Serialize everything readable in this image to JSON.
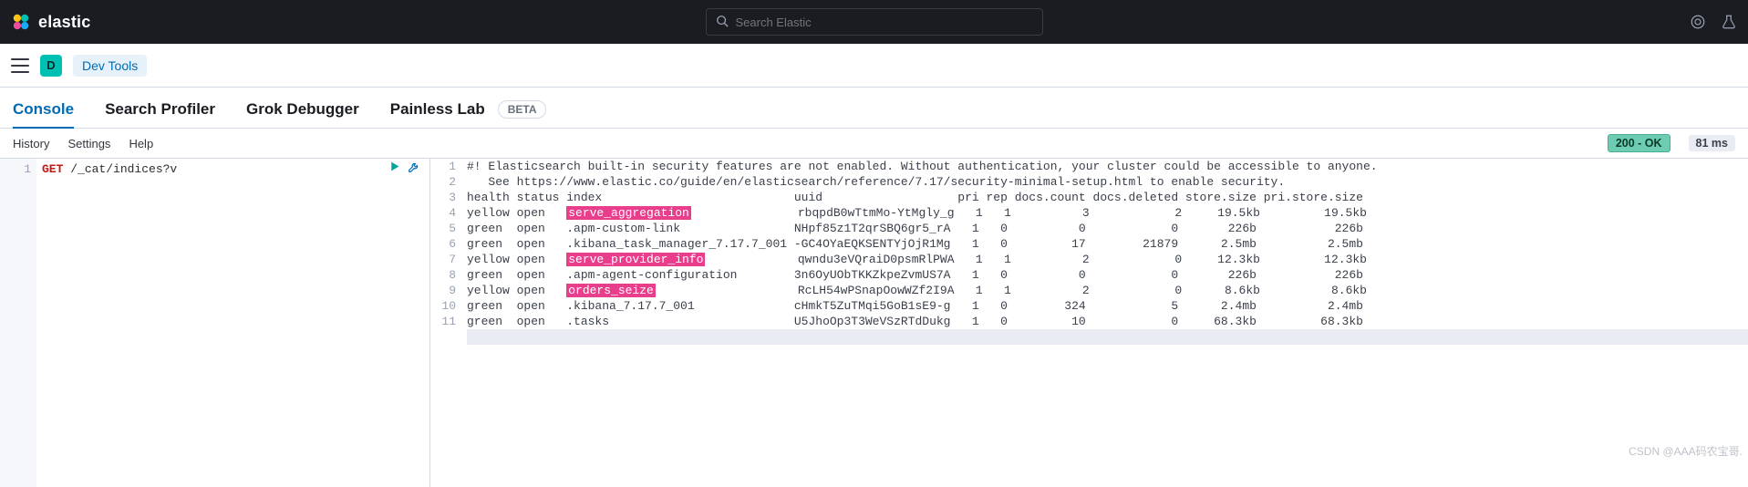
{
  "header": {
    "brand": "elastic",
    "search_placeholder": "Search Elastic"
  },
  "secondbar": {
    "space_letter": "D",
    "breadcrumb": "Dev Tools"
  },
  "tabs": {
    "console": "Console",
    "search_profiler": "Search Profiler",
    "grok": "Grok Debugger",
    "painless": "Painless Lab",
    "beta": "BETA"
  },
  "toolbar": {
    "history": "History",
    "settings": "Settings",
    "help": "Help",
    "status": "200 - OK",
    "ms": "81 ms"
  },
  "request": {
    "line_no": "1",
    "method": "GET",
    "path": "/_cat/indices?v"
  },
  "response": {
    "gutter": [
      "1",
      "2",
      "3",
      "4",
      "5",
      "6",
      "7",
      "8",
      "9",
      "10",
      "11"
    ],
    "line1": "#! Elasticsearch built-in security features are not enabled. Without authentication, your cluster could be accessible to anyone.",
    "line1b": "   See https://www.elastic.co/guide/en/elasticsearch/reference/7.17/security-minimal-setup.html to enable security.",
    "header_row": "health status index                           uuid                   pri rep docs.count docs.deleted store.size pri.store.size",
    "rows": [
      {
        "pre": "yellow open   ",
        "idx": "serve_aggregation",
        "post": "               rbqpdB0wTtmMo-YtMgly_g   1   1          3            2     19.5kb         19.5kb",
        "hl": true
      },
      {
        "pre": "green  open   ",
        "idx": ".apm-custom-link",
        "post": "                NHpf85z1T2qrSBQ6gr5_rA   1   0          0            0       226b           226b",
        "hl": false
      },
      {
        "pre": "green  open   ",
        "idx": ".kibana_task_manager_7.17.7_001",
        "post": " -GC4OYaEQKSENTYjOjR1Mg   1   0         17        21879      2.5mb          2.5mb",
        "hl": false
      },
      {
        "pre": "yellow open   ",
        "idx": "serve_provider_info",
        "post": "             qwndu3eVQraiD0psmRlPWA   1   1          2            0     12.3kb         12.3kb",
        "hl": true
      },
      {
        "pre": "green  open   ",
        "idx": ".apm-agent-configuration",
        "post": "        3n6OyUObTKKZkpeZvmUS7A   1   0          0            0       226b           226b",
        "hl": false
      },
      {
        "pre": "yellow open   ",
        "idx": "orders_seize",
        "post": "                    RcLH54wPSnapOowWZf2I9A   1   1          2            0      8.6kb          8.6kb",
        "hl": true
      },
      {
        "pre": "green  open   ",
        "idx": ".kibana_7.17.7_001",
        "post": "              cHmkT5ZuTMqi5GoB1sE9-g   1   0        324            5      2.4mb          2.4mb",
        "hl": false
      },
      {
        "pre": "green  open   ",
        "idx": ".tasks",
        "post": "                          U5JhoOp3T3WeVSzRTdDukg   1   0         10            0     68.3kb         68.3kb",
        "hl": false
      }
    ]
  },
  "watermark": "CSDN @AAA码农宝哥."
}
